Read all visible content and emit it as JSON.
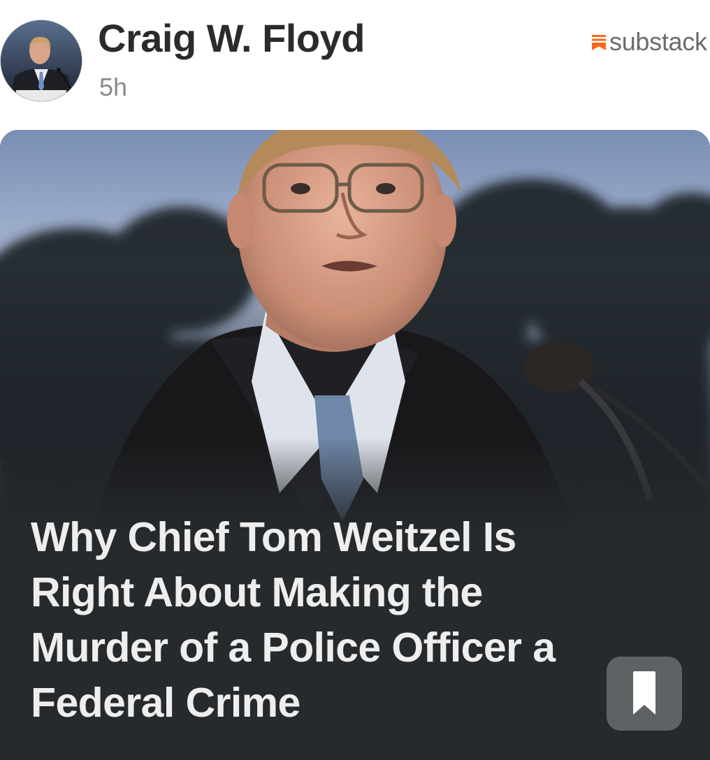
{
  "post": {
    "author": {
      "name": "Craig W. Floyd",
      "avatar_alt": "avatar"
    },
    "timestamp": "5h",
    "source": {
      "label": "substack",
      "icon": "substack-icon",
      "accent_color": "#ff6719"
    },
    "card": {
      "headline": "Why Chief Tom Weitzel Is Right About Making the Murder of a Police Officer a Federal Crime",
      "save_icon": "bookmark-icon"
    }
  }
}
